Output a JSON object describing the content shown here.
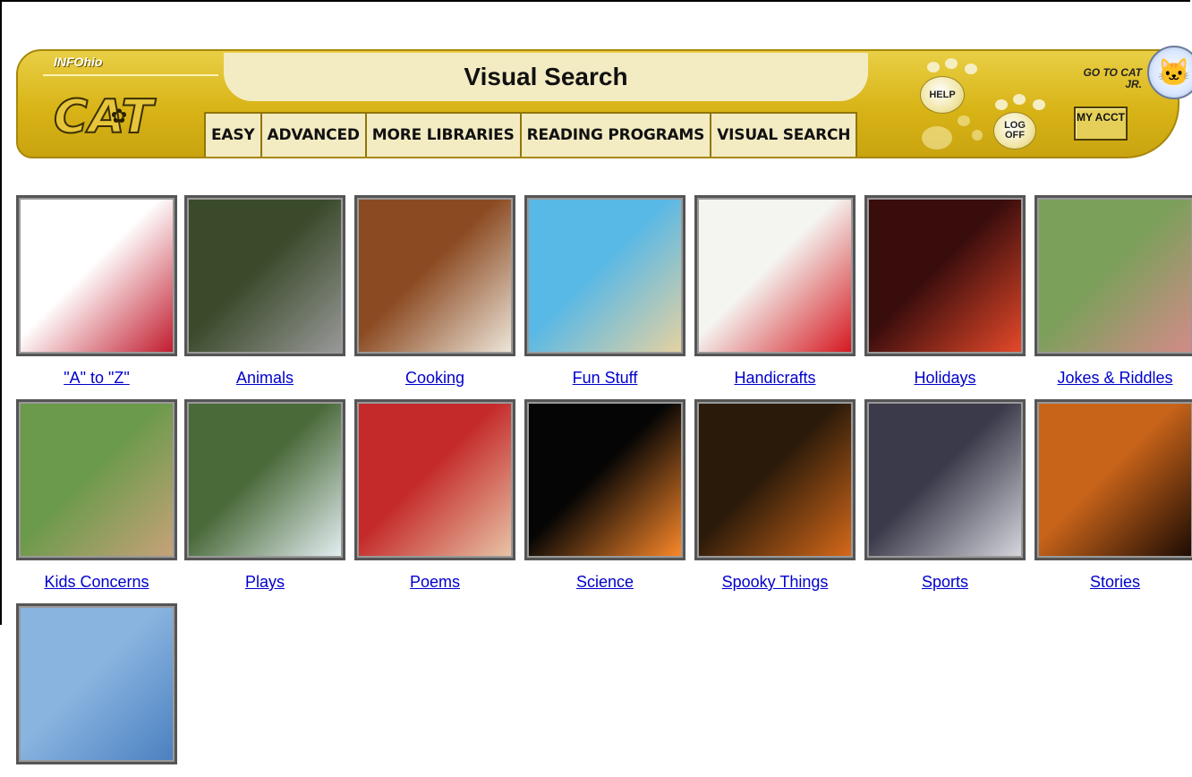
{
  "banner": {
    "brand_small": "INFOhio",
    "brand_logo": "CAT",
    "title": "Visual Search",
    "tabs": [
      "EASY",
      "ADVANCED",
      "MORE LIBRARIES",
      "READING PROGRAMS",
      "VISUAL SEARCH"
    ],
    "help_label": "HELP",
    "logoff_label": "LOG OFF",
    "goto_label": "GO TO CAT JR.",
    "myacct_label": "MY ACCT"
  },
  "categories": [
    {
      "label": "\"A\" to \"Z\"",
      "icon": "apple-zebra-image",
      "colors": [
        "#ffffff",
        "#c0182a"
      ]
    },
    {
      "label": "Animals",
      "icon": "dog-image",
      "colors": [
        "#3a4a2a",
        "#9a9a9a"
      ]
    },
    {
      "label": "Cooking",
      "icon": "brownies-image",
      "colors": [
        "#8b4a22",
        "#efe8dc"
      ]
    },
    {
      "label": "Fun Stuff",
      "icon": "beach-kid-image",
      "colors": [
        "#58b8e6",
        "#e7d2a0"
      ]
    },
    {
      "label": "Handicrafts",
      "icon": "handprints-image",
      "colors": [
        "#f4f4f0",
        "#d4141c"
      ]
    },
    {
      "label": "Holidays",
      "icon": "lights-image",
      "colors": [
        "#3a0d0d",
        "#e84a2a"
      ]
    },
    {
      "label": "Jokes & Riddles",
      "icon": "girls-image",
      "colors": [
        "#7aa05a",
        "#d58a8a"
      ]
    },
    {
      "label": "Kids Concerns",
      "icon": "kids-grass-image",
      "colors": [
        "#6a9a4a",
        "#c8a27a"
      ]
    },
    {
      "label": "Plays",
      "icon": "costumes-image",
      "colors": [
        "#4a6a3a",
        "#e6f0f4"
      ]
    },
    {
      "label": "Poems",
      "icon": "woman-image",
      "colors": [
        "#c42a2a",
        "#e8c6a8"
      ]
    },
    {
      "label": "Science",
      "icon": "eclipse-image",
      "colors": [
        "#050505",
        "#ff8a2a"
      ]
    },
    {
      "label": "Spooky Things",
      "icon": "pumpkin-image",
      "colors": [
        "#2a1a0a",
        "#d86a1a"
      ]
    },
    {
      "label": "Sports",
      "icon": "basketball-image",
      "colors": [
        "#3a3a4a",
        "#d8d8e0"
      ]
    },
    {
      "label": "Stories",
      "icon": "silhouette-image",
      "colors": [
        "#c8641a",
        "#1a0a04"
      ]
    },
    {
      "label": "",
      "icon": "sky-image",
      "colors": [
        "#8ab4e0",
        "#4a80c0"
      ]
    }
  ]
}
